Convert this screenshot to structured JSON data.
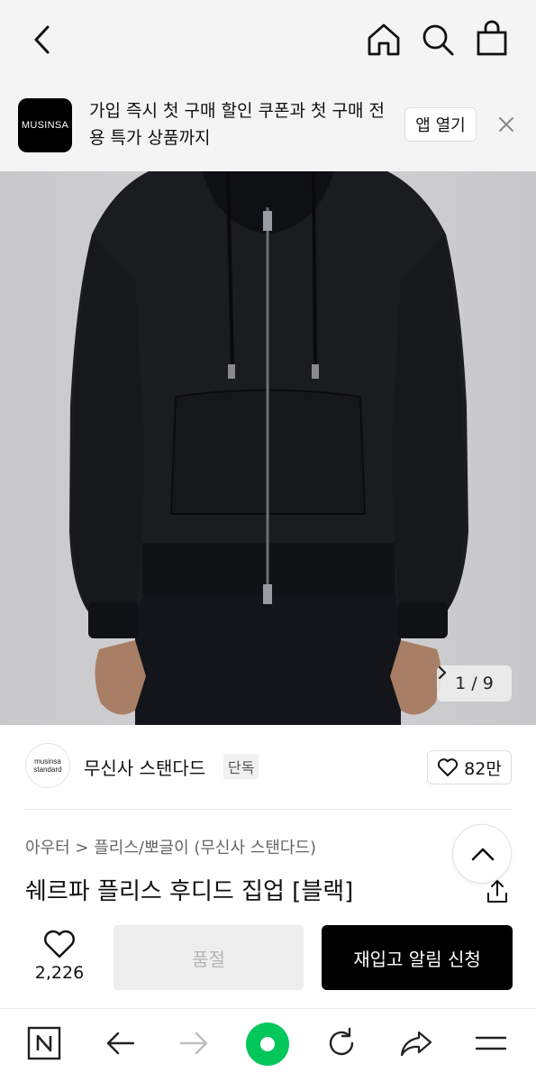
{
  "header": {
    "back_icon": "chevron-left-icon",
    "home_icon": "home-icon",
    "search_icon": "search-icon",
    "bag_icon": "shopping-bag-icon"
  },
  "banner": {
    "logo_text": "MUSINSA",
    "message": "가입 즉시 첫 구매 할인 쿠폰과 첫 구매 전용 특가 상품까지",
    "open_app_label": "앱 열기",
    "close_icon": "close-icon"
  },
  "gallery": {
    "current": "1",
    "separator": "/",
    "total": "9",
    "next_icon": "chevron-right-icon"
  },
  "brand": {
    "logo_line1": "musinsa",
    "logo_line2": "standard",
    "name": "무신사 스탠다드",
    "tag": "단독",
    "likes": "82만"
  },
  "product": {
    "breadcrumb": "아우터 > 플리스/뽀글이 (무신사 스탠다드)",
    "title": "쉐르파 플리스 후디드 집업 [블랙]"
  },
  "actions": {
    "wish_count": "2,226",
    "soldout_label": "품절",
    "restock_label": "재입고 알림 신청"
  },
  "bottom_nav": {
    "items": [
      "naver-n-icon",
      "back-arrow-icon",
      "forward-arrow-icon",
      "green-dot-icon",
      "refresh-icon",
      "share-arrow-icon",
      "menu-icon"
    ]
  },
  "colors": {
    "accent_green": "#03c75a",
    "bar_bg": "#f4f4f4",
    "button_black": "#000000"
  }
}
